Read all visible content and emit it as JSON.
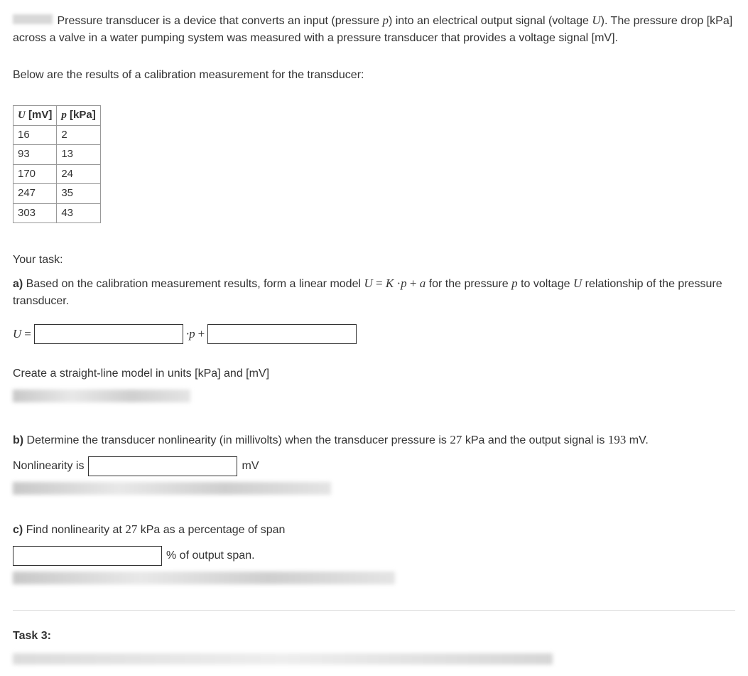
{
  "intro": {
    "text1": "Pressure transducer is a device  that converts an input (pressure ",
    "var_p": "p",
    "text2": ") into an electrical output signal (voltage ",
    "var_U": "U",
    "text3": "). The pressure drop [kPa] across a valve in a water pumping system was measured with a pressure transducer that provides a voltage signal [mV]."
  },
  "calib_text": "Below are the results of a calibration measurement for the transducer:",
  "table": {
    "h1_var": "U",
    "h1_unit": " [mV]",
    "h2_var": "p",
    "h2_unit": " [kPa]",
    "rows": [
      {
        "u": "16",
        "p": "2"
      },
      {
        "u": "93",
        "p": "13"
      },
      {
        "u": "170",
        "p": "24"
      },
      {
        "u": "247",
        "p": "35"
      },
      {
        "u": "303",
        "p": "43"
      }
    ]
  },
  "your_task": "Your task:",
  "part_a": {
    "label": "a)",
    "t1": " Based on the calibration measurement results, form a linear model ",
    "eq_U": "U",
    "eq_eq": " = ",
    "eq_K": "K",
    "eq_dot": " ·",
    "eq_p": "p",
    "eq_plus": " + ",
    "eq_a": "a",
    "t2": "  for the pressure ",
    "var_p": "p",
    "t3": " to voltage ",
    "var_U": "U",
    "t4": " relationship of the pressure transducer.",
    "line_U": "U",
    "line_eq": " =",
    "line_dotp": "·p",
    "line_plus": " +",
    "instr": "Create a straight-line model in units [kPa] and [mV]"
  },
  "part_b": {
    "label": "b)",
    "t1": " Determine the transducer nonlinearity (in millivolts) when the transducer pressure is ",
    "val27": "27",
    "t2": " kPa and the output signal is ",
    "val193": "193",
    "t3": " mV.",
    "nl_label": "Nonlinearity is",
    "unit": "mV"
  },
  "part_c": {
    "label": "c)",
    "t1": " Find nonlinearity at ",
    "val27": "27",
    "t2": " kPa as a percentage of span",
    "unit": "% of output span."
  },
  "task3": "Task 3:"
}
